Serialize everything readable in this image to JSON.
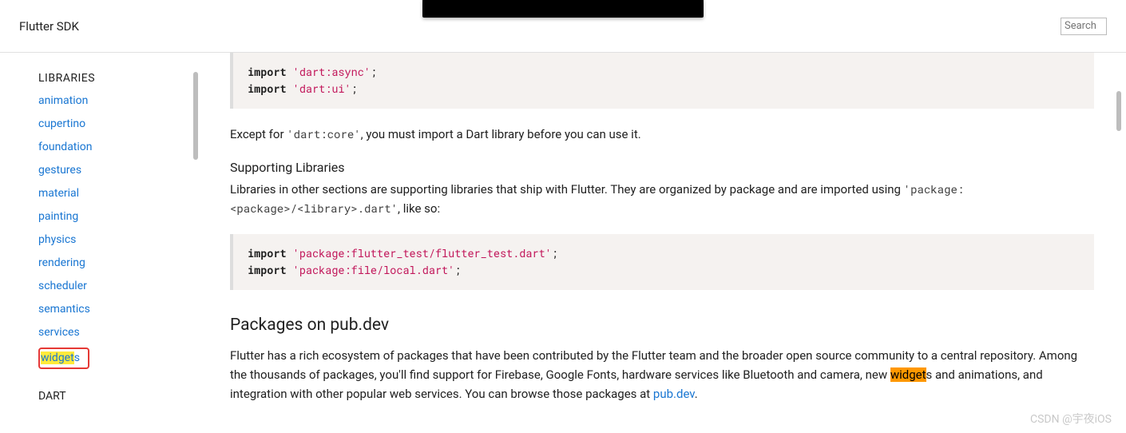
{
  "header": {
    "title": "Flutter SDK",
    "search_placeholder": "Search"
  },
  "sidebar": {
    "section_libraries": "LIBRARIES",
    "items": [
      "animation",
      "cupertino",
      "foundation",
      "gestures",
      "material",
      "painting",
      "physics",
      "rendering",
      "scheduler",
      "semantics",
      "services"
    ],
    "highlighted_item_prefix": "widget",
    "highlighted_item_suffix": "s",
    "section_dart": "DART"
  },
  "main": {
    "code1": {
      "line1": {
        "kw": "import",
        "str": "'dart:async'",
        "end": ";"
      },
      "line2": {
        "kw": "import",
        "str": "'dart:ui'",
        "end": ";"
      }
    },
    "para1_a": "Except for ",
    "para1_code": "'dart:core'",
    "para1_b": ", you must import a Dart library before you can use it.",
    "heading_supporting": "Supporting Libraries",
    "para2_a": "Libraries in other sections are supporting libraries that ship with Flutter. They are organized by package and are imported using ",
    "para2_code": "'package:<package>/<library>.dart'",
    "para2_b": ", like so:",
    "code2": {
      "line1": {
        "kw": "import",
        "str": "'package:flutter_test/flutter_test.dart'",
        "end": ";"
      },
      "line2": {
        "kw": "import",
        "str": "'package:file/local.dart'",
        "end": ";"
      }
    },
    "heading_packages": "Packages on pub.dev",
    "para3_a": "Flutter has a rich ecosystem of packages that have been contributed by the Flutter team and the broader open source community to a central repository. Among the thousands of packages, you'll find support for Firebase, Google Fonts, hardware services like Bluetooth and camera, new ",
    "para3_hl": "widget",
    "para3_b": "s and animations, and integration with other popular web services. You can browse those packages at ",
    "para3_link": "pub.dev",
    "para3_c": "."
  },
  "watermark": "CSDN @宇夜iOS"
}
